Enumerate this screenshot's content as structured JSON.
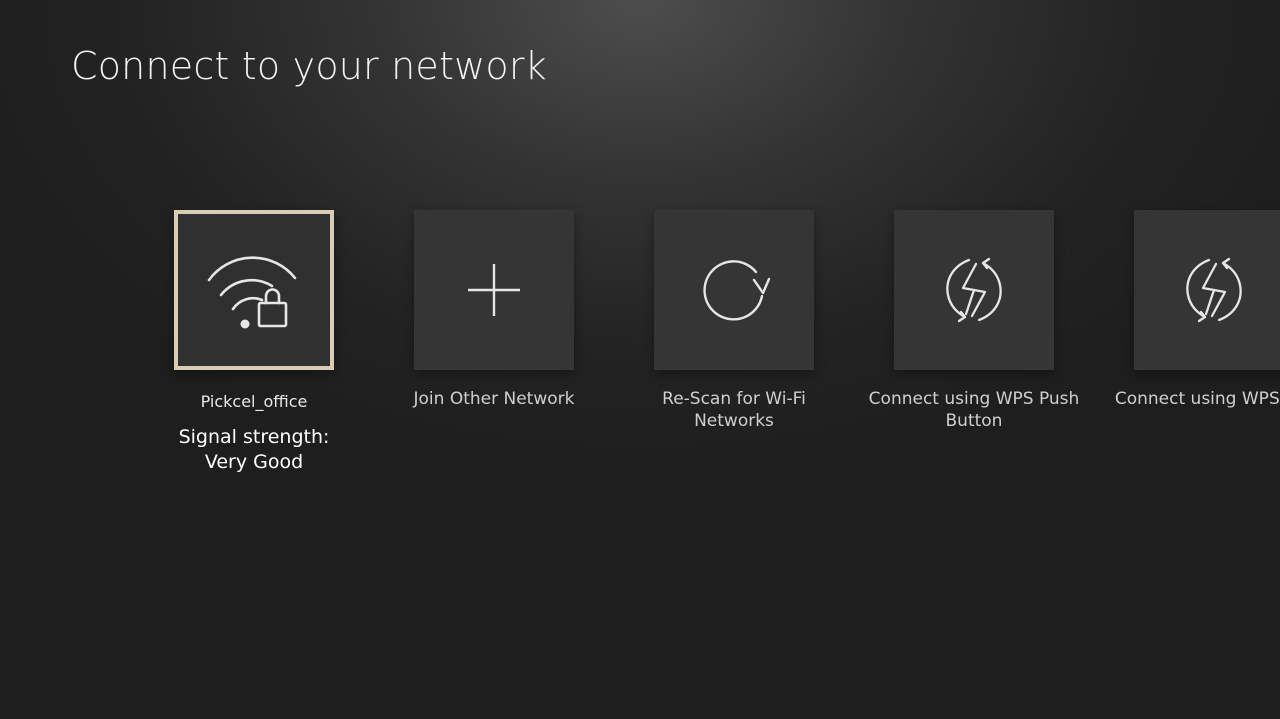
{
  "page": {
    "title": "Connect to your network"
  },
  "networks": [
    {
      "name": "Pickcel_office",
      "icon": "wifi-locked-icon",
      "signal_label": "Signal strength:",
      "signal_value": "Very Good",
      "focused": true
    }
  ],
  "actions": [
    {
      "label": "Join Other Network",
      "icon": "plus-icon"
    },
    {
      "label": "Re-Scan for Wi-Fi Networks",
      "icon": "refresh-icon"
    },
    {
      "label": "Connect using WPS Push Button",
      "icon": "wps-icon"
    },
    {
      "label": "Connect using WPS PIN",
      "icon": "wps-icon"
    }
  ],
  "colors": {
    "focus_border": "#d9cdb6",
    "tile_background": "#353535",
    "icon_stroke": "#e6e6e6"
  }
}
